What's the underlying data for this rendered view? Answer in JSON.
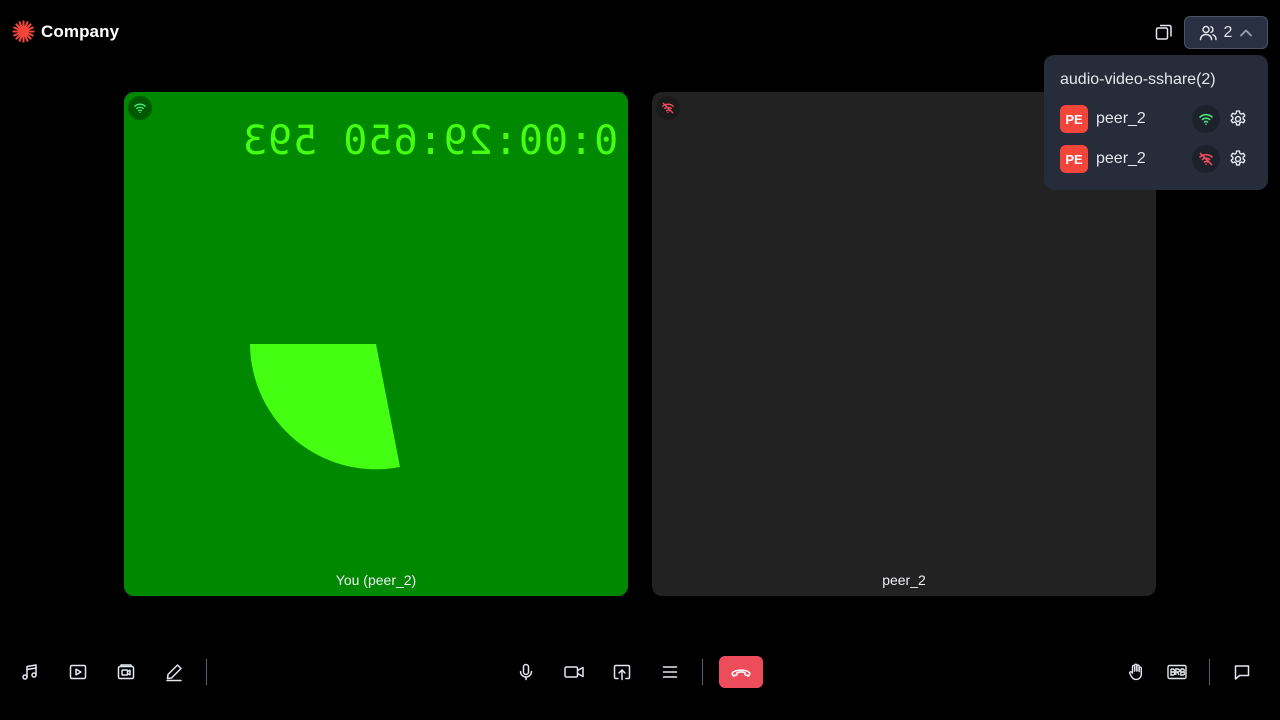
{
  "app": {
    "brand_name": "Company",
    "accent_color": "#f4453b"
  },
  "header": {
    "participant_count": "2"
  },
  "popover": {
    "title": "audio-video-sshare(2)",
    "peers": [
      {
        "initials": "PE",
        "name": "peer_2",
        "network": "good"
      },
      {
        "initials": "PE",
        "name": "peer_2",
        "network": "poor"
      }
    ]
  },
  "tiles": [
    {
      "name": "You (peer_2)",
      "network": "good",
      "background": "#008800",
      "timer_text": "0:00:29:650 593"
    },
    {
      "name": "peer_2",
      "network": "poor",
      "background": "#222222"
    }
  ],
  "footer": {
    "left_icons": [
      "music-icon",
      "video-play-icon",
      "screen-share-video-icon",
      "pencil-icon"
    ],
    "center_icons": [
      "microphone-icon",
      "camera-icon",
      "share-screen-icon",
      "menu-icon",
      "leave-call-icon"
    ],
    "right_icons": [
      "raise-hand-icon",
      "brb-icon",
      "chat-icon"
    ],
    "leave_color": "#ed4c5a"
  }
}
